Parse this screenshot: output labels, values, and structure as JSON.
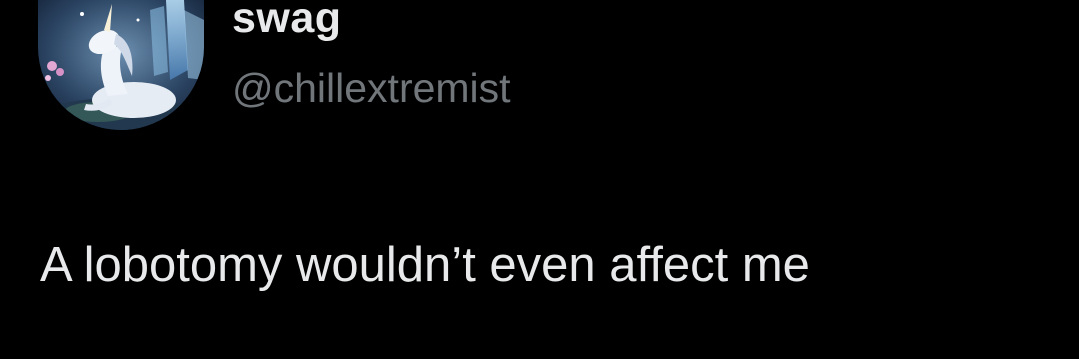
{
  "tweet": {
    "author": {
      "display_name": "swag",
      "handle": "@chillextremist",
      "avatar_icon": "unicorn-avatar-icon"
    },
    "text": "A lobotomy wouldn’t even affect me"
  },
  "colors": {
    "background": "#000000",
    "primary_text": "#e7e9ea",
    "secondary_text": "#71767b"
  }
}
